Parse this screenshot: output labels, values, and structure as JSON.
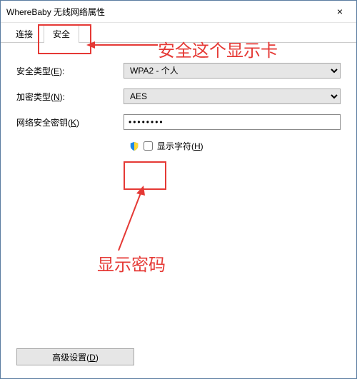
{
  "window": {
    "title": "WhereBaby 无线网络属性",
    "close_label": "×"
  },
  "tabs": {
    "connect": "连接",
    "security": "安全"
  },
  "form": {
    "security_type_label": "安全类型(",
    "security_type_key": "E",
    "security_type_suffix": "):",
    "security_type_value": "WPA2 - 个人",
    "encryption_label": "加密类型(",
    "encryption_key": "N",
    "encryption_suffix": "):",
    "encryption_value": "AES",
    "key_label": "网络安全密钥(",
    "key_key": "K",
    "key_suffix": ")",
    "key_value": "••••••••",
    "show_chars_label": "显示字符(",
    "show_chars_key": "H",
    "show_chars_suffix": ")",
    "advanced_label": "高级设置(",
    "advanced_key": "D",
    "advanced_suffix": ")"
  },
  "annotations": {
    "tab_note": "安全这个显示卡",
    "pwd_note": "显示密码"
  }
}
